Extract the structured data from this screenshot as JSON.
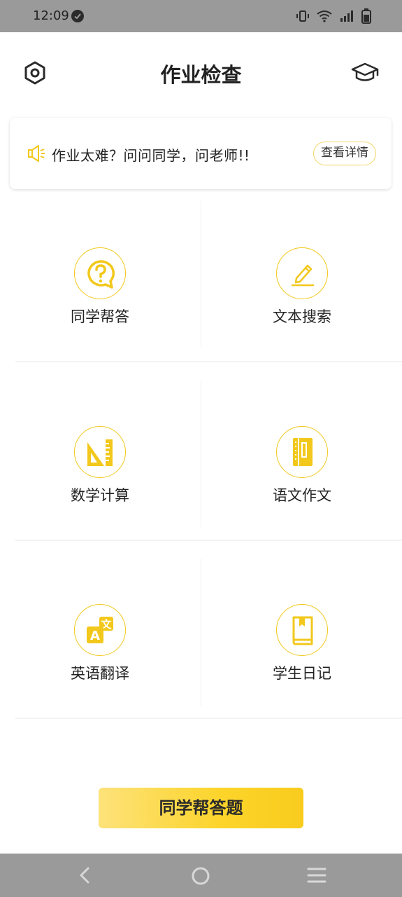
{
  "status_bar": {
    "time": "12:09"
  },
  "header": {
    "title": "作业检查",
    "settings_icon": "settings-hexagon-icon",
    "right_icon": "graduation-cap-icon"
  },
  "notice": {
    "icon": "megaphone-icon",
    "text": "作业太难？问问同学，问老师!!",
    "detail_label": "查看详情"
  },
  "grid": {
    "items": [
      {
        "label": "同学帮答",
        "icon": "question-bubble-icon"
      },
      {
        "label": "文本搜索",
        "icon": "pencil-icon"
      },
      {
        "label": "数学计算",
        "icon": "ruler-triangle-icon"
      },
      {
        "label": "语文作文",
        "icon": "notebook-icon"
      },
      {
        "label": "英语翻译",
        "icon": "translate-icon"
      },
      {
        "label": "学生日记",
        "icon": "diary-book-icon"
      }
    ]
  },
  "cta": {
    "label": "同学帮答题"
  },
  "colors": {
    "accent": "#f2c81c",
    "status_bar": "#9a9a9a",
    "cta_gradient_start": "#fde27a",
    "cta_gradient_end": "#f9cc1e"
  }
}
